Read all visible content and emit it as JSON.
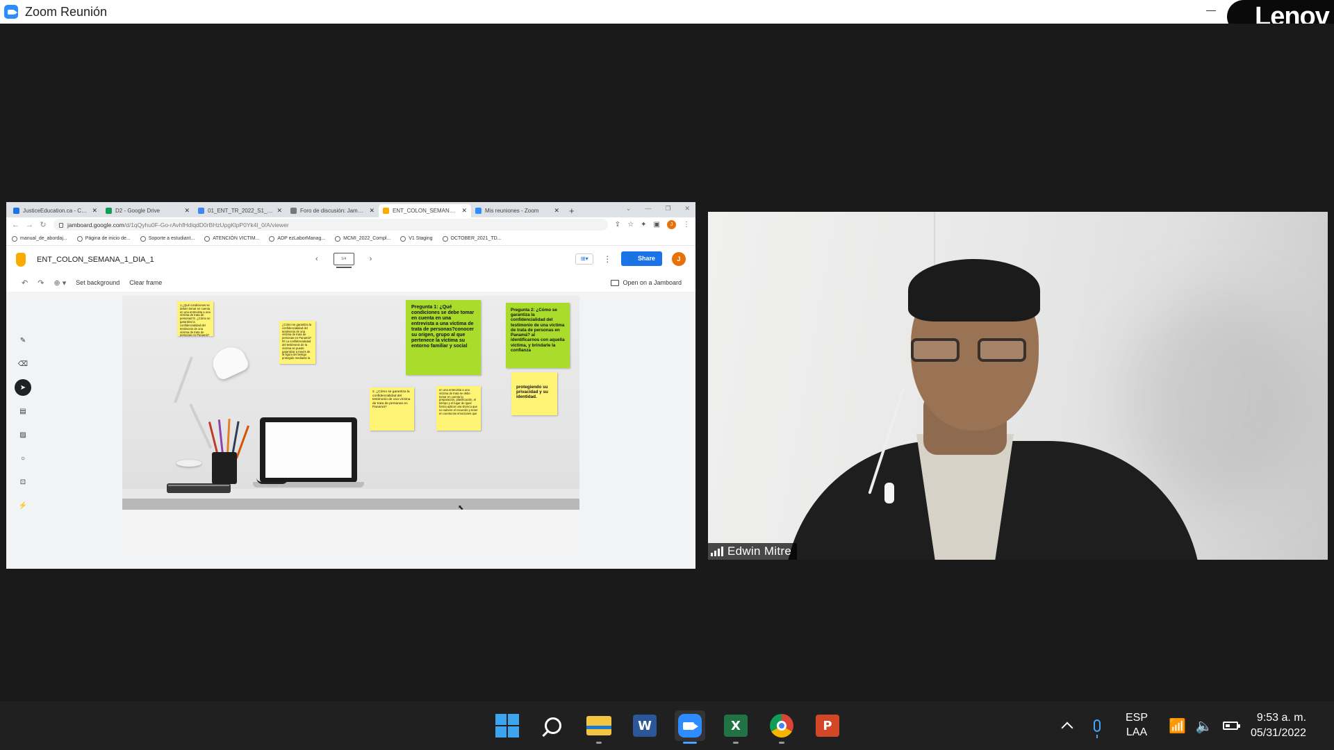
{
  "window": {
    "title": "Zoom Reunión",
    "lenovo_text": "Lenov"
  },
  "browser": {
    "tabs": [
      {
        "label": "JusticeEducation.ca - Calendar",
        "color": "#1a73e8",
        "active": false
      },
      {
        "label": "D2 - Google Drive",
        "color": "#0f9d58",
        "active": false
      },
      {
        "label": "01_ENT_TR_2022_S1_D2_Fi",
        "color": "#4285f4",
        "active": false
      },
      {
        "label": "Foro de discusión: Jamboard",
        "color": "#777777",
        "active": false
      },
      {
        "label": "ENT_COLON_SEMANA_1_D",
        "color": "#f9ab00",
        "active": true
      },
      {
        "label": "Mis reuniones - Zoom",
        "color": "#2d8cff",
        "active": false
      }
    ],
    "url_host": "jamboard.google.com",
    "url_path": "/d/1qQyhu0F-Go-rAvhfHdiqdD0rBHzUpgKlpP0Yk4l_0/A/viewer",
    "bookmarks": [
      "manual_de_abordaj...",
      "Página de inicio de...",
      "Soporte a estudiant...",
      "ATENCIÓN VICTIM...",
      "ADP ezLaborManag...",
      "MCMI_2022_Compl...",
      "V1 Staging",
      "OCTOBER_2021_TD..."
    ],
    "profile_initial": "J"
  },
  "jamboard": {
    "title": "ENT_COLON_SEMANA_1_DIA_1",
    "frame_indicator": "1/4",
    "share_label": "Share",
    "avatar_initial": "J",
    "toolbar": {
      "set_background": "Set background",
      "clear_frame": "Clear frame",
      "open_on_jamboard": "Open on a Jamboard"
    },
    "notes": {
      "n1": "1.¿Qué condiciones se deben tomar en cuenta en una entrevista a una víctima de trata de personas?2. ¿Cómo se garantiza la confidencialidad del testimonio de una víctima de trata de personas en Panamá?",
      "n2": "¿Cómo se garantiza la confidencialidad del testimonio de una víctima de trata de personas en Panamá? R/ La confidencialidad del testimonio de la víctima se puede garantizar a través de la figura del testigo protegido mediante la",
      "n3": "Pregunta 1: ¿Qué condiciones se debe tomar en cuenta en una entrevista a una víctima de trata de personas?conocer su origen, grupo al que pertenece la víctima su entorno familiar y social",
      "n4": "Pregunta 2: ¿Cómo se garantiza la confidencialidad del testimonio de una víctima de trata de personas en Panamá? al identificarnos con aquella víctima, y brindarle la confianza",
      "n5": "2. ¿Cómo se garantiza la confidencialidad del testimonio de una víctima de trata de personas en Panamá?",
      "n6": "en una entrevista a una víctima de trata se debe tomar en cuenta la preparación, planificación, el tiempo y el lugar de igual forma aplicar una técnica que no vulnere el recuerdo y tener en cuenta las emociones que",
      "n7": "protegiendo su privacidad y su identidad."
    }
  },
  "participant": {
    "name": "Edwin Mitre"
  },
  "taskbar": {
    "word_letter": "W",
    "excel_letter": "X",
    "ppt_letter": "P",
    "lang_line1": "ESP",
    "lang_line2": "LAA",
    "time": "9:53 a. m.",
    "date": "05/31/2022"
  }
}
